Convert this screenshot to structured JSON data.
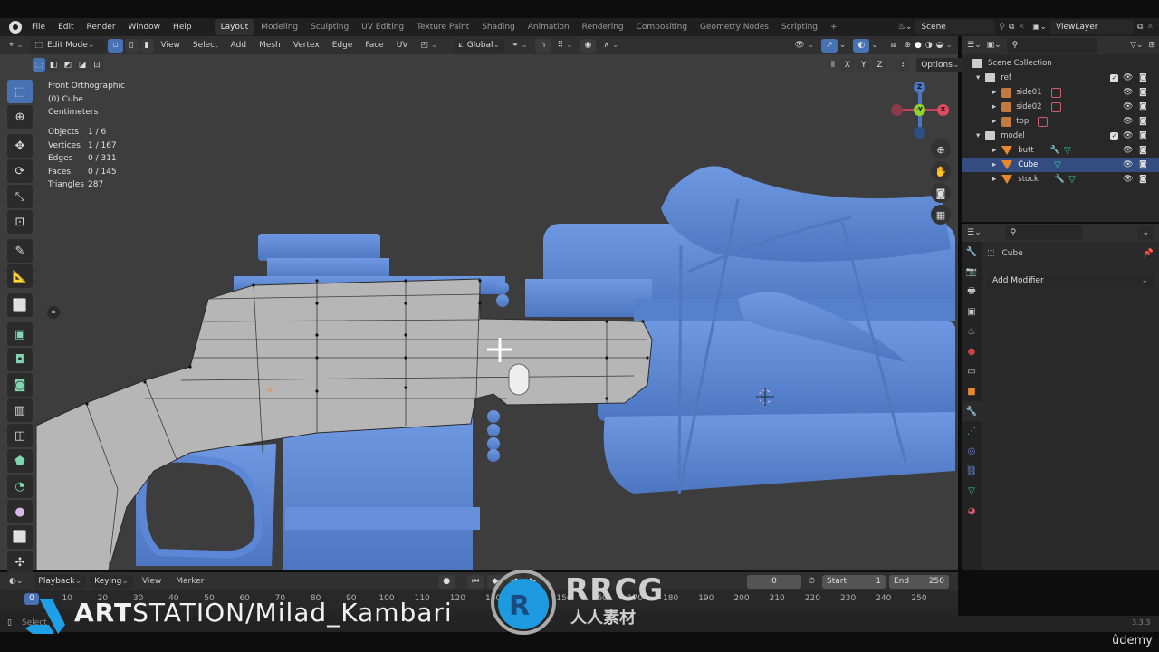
{
  "topbar": {
    "menus": [
      "File",
      "Edit",
      "Render",
      "Window",
      "Help"
    ],
    "workspaces": [
      "Layout",
      "Modeling",
      "Sculpting",
      "UV Editing",
      "Texture Paint",
      "Shading",
      "Animation",
      "Rendering",
      "Compositing",
      "Geometry Nodes",
      "Scripting"
    ],
    "active_workspace": "Layout",
    "add_workspace": "+",
    "scene": "Scene",
    "view_layer": "ViewLayer"
  },
  "viewport_header": {
    "mode": "Edit Mode",
    "menus": [
      "View",
      "Select",
      "Add",
      "Mesh",
      "Vertex",
      "Edge",
      "Face",
      "UV"
    ],
    "transform_orientation": "Global",
    "axis_x": "X",
    "axis_y": "Y",
    "axis_z": "Z",
    "options": "Options"
  },
  "overlay_info": {
    "view": "Front Orthographic",
    "object": "(0) Cube",
    "units": "Centimeters",
    "stats": [
      {
        "label": "Objects",
        "value": "1 / 6"
      },
      {
        "label": "Vertices",
        "value": "1 / 167"
      },
      {
        "label": "Edges",
        "value": "0 / 311"
      },
      {
        "label": "Faces",
        "value": "0 / 145"
      },
      {
        "label": "Triangles",
        "value": "287"
      }
    ]
  },
  "gizmo": {
    "z": "Z",
    "y": "-Y",
    "x": "X"
  },
  "outliner": {
    "root": "Scene Collection",
    "rows": [
      {
        "name": "ref",
        "type": "collection",
        "level": 0
      },
      {
        "name": "side01",
        "type": "image",
        "level": 1
      },
      {
        "name": "side02",
        "type": "image",
        "level": 1
      },
      {
        "name": "top",
        "type": "image",
        "level": 1
      },
      {
        "name": "model",
        "type": "collection",
        "level": 0
      },
      {
        "name": "butt",
        "type": "mesh",
        "level": 1
      },
      {
        "name": "Cube",
        "type": "mesh",
        "level": 1,
        "selected": true
      },
      {
        "name": "stock",
        "type": "mesh",
        "level": 1
      }
    ]
  },
  "properties": {
    "object_name": "Cube",
    "add_modifier": "Add Modifier"
  },
  "timeline": {
    "menus": [
      "Playback",
      "Keying",
      "View",
      "Marker"
    ],
    "current_frame": "0",
    "start_label": "Start",
    "start": "1",
    "end_label": "End",
    "end": "250",
    "ticks": [
      "0",
      "10",
      "20",
      "30",
      "40",
      "50",
      "60",
      "70",
      "80",
      "90",
      "100",
      "110",
      "120",
      "130",
      "140",
      "150",
      "160",
      "170",
      "180",
      "190",
      "200",
      "210",
      "220",
      "230",
      "240",
      "250"
    ]
  },
  "status": {
    "select": "Select",
    "version": "3.3.3"
  },
  "watermarks": {
    "artstation_bold": "ART",
    "artstation_rest": "STATION/Milad_Kambari",
    "rrcg": "RRCG",
    "rrcg_sub": "人人素材",
    "udemy": "ûdemy"
  },
  "colors": {
    "accent": "#4772b3",
    "mesh_blue": "#5b87d6",
    "edit_mesh": "#b4b4b4",
    "viewport_bg": "#3d3d3d"
  }
}
